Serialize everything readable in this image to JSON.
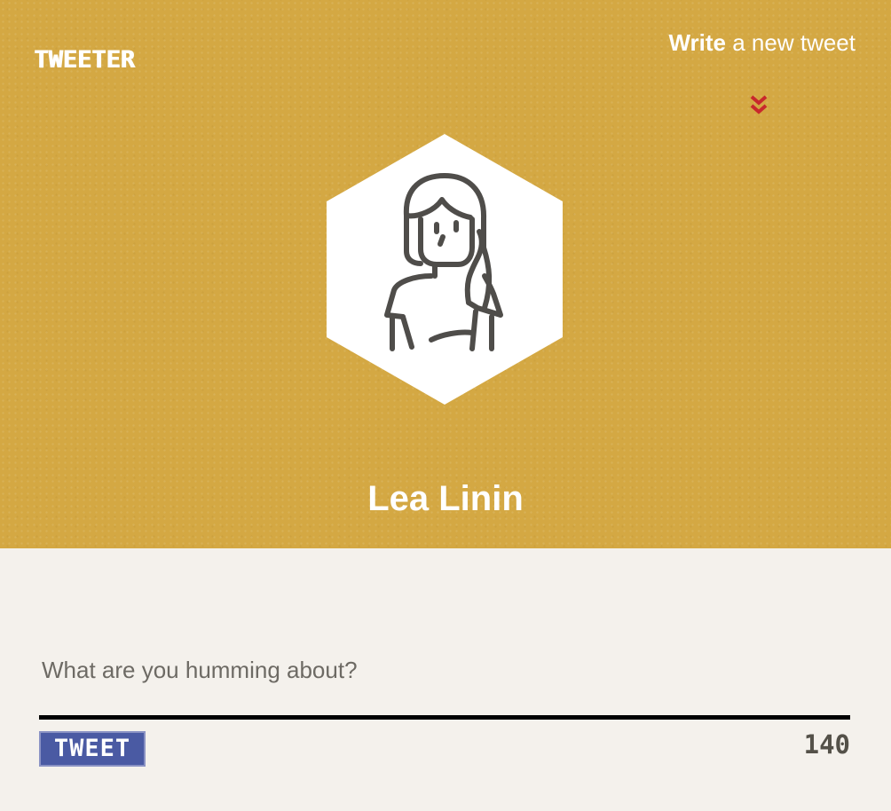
{
  "header": {
    "brand": "TWEETER",
    "write_bold": "Write",
    "write_rest": " a new tweet",
    "chevron_icon": "double-chevron-down-icon",
    "accent_color": "#d4a843",
    "chevron_color": "#c8282c"
  },
  "profile": {
    "avatar_icon": "woman-avatar-icon",
    "name": "Lea Linin"
  },
  "compose": {
    "placeholder": "What are you humming about?",
    "button_label": "TWEET",
    "button_color": "#4a5aa3",
    "char_count": "140"
  }
}
